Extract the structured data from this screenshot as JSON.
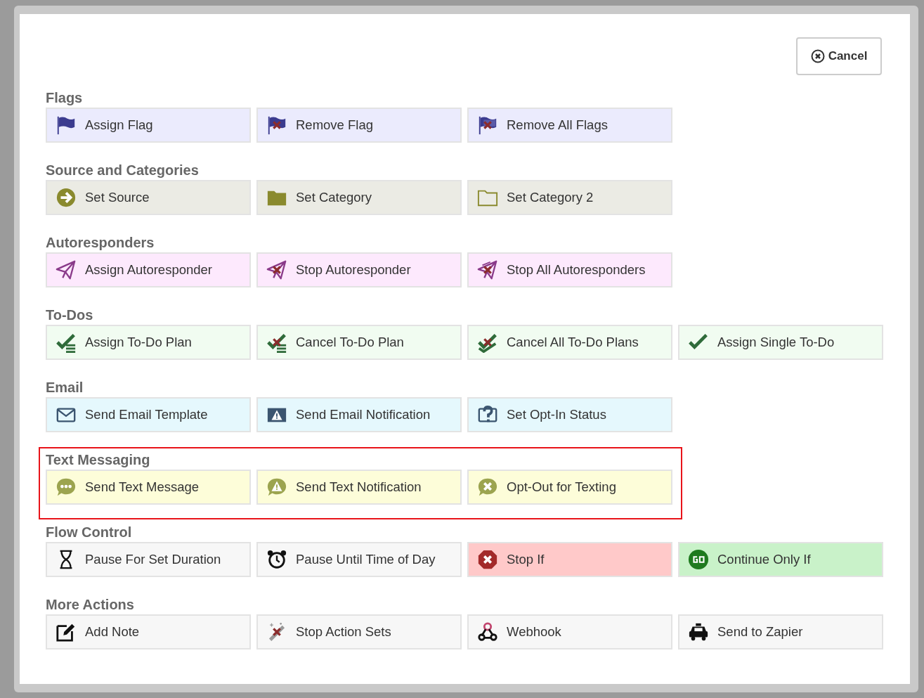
{
  "cancel_button": {
    "label": "Cancel"
  },
  "sections": [
    {
      "title": "Flags",
      "highlighted": false,
      "actions": [
        {
          "label": "Assign Flag",
          "color": "#ebebfd"
        },
        {
          "label": "Remove Flag",
          "color": "#ebebfd"
        },
        {
          "label": "Remove All Flags",
          "color": "#ebebfd"
        }
      ]
    },
    {
      "title": "Source and Categories",
      "highlighted": false,
      "actions": [
        {
          "label": "Set Source",
          "color": "#ebebe4"
        },
        {
          "label": "Set Category",
          "color": "#ebebe4"
        },
        {
          "label": "Set Category 2",
          "color": "#ebebe4"
        }
      ]
    },
    {
      "title": "Autoresponders",
      "highlighted": false,
      "actions": [
        {
          "label": "Assign Autoresponder",
          "color": "#fde9fd"
        },
        {
          "label": "Stop Autoresponder",
          "color": "#fde9fd"
        },
        {
          "label": "Stop All Autoresponders",
          "color": "#fde9fd"
        }
      ]
    },
    {
      "title": "To-Dos",
      "highlighted": false,
      "actions": [
        {
          "label": "Assign To-Do Plan",
          "color": "#f1fcf1"
        },
        {
          "label": "Cancel To-Do Plan",
          "color": "#f1fcf1"
        },
        {
          "label": "Cancel All To-Do Plans",
          "color": "#f1fcf1"
        },
        {
          "label": "Assign Single To-Do",
          "color": "#f1fcf1"
        }
      ]
    },
    {
      "title": "Email",
      "highlighted": false,
      "actions": [
        {
          "label": "Send Email Template",
          "color": "#e5f8fd"
        },
        {
          "label": "Send Email Notification",
          "color": "#e5f8fd"
        },
        {
          "label": "Set Opt-In Status",
          "color": "#e5f8fd"
        }
      ]
    },
    {
      "title": "Text Messaging",
      "highlighted": true,
      "actions": [
        {
          "label": "Send Text Message",
          "color": "#fdfdd9"
        },
        {
          "label": "Send Text Notification",
          "color": "#fdfdd9"
        },
        {
          "label": "Opt-Out for Texting",
          "color": "#fdfdd9"
        }
      ]
    },
    {
      "title": "Flow Control",
      "highlighted": false,
      "actions": [
        {
          "label": "Pause For Set Duration",
          "color": "#f7f7f7"
        },
        {
          "label": "Pause Until Time of Day",
          "color": "#f7f7f7"
        },
        {
          "label": "Stop If",
          "color": "#ffc9c9"
        },
        {
          "label": "Continue Only If",
          "color": "#c9f2c9"
        }
      ]
    },
    {
      "title": "More Actions",
      "highlighted": false,
      "actions": [
        {
          "label": "Add Note",
          "color": "#f7f7f7"
        },
        {
          "label": "Stop Action Sets",
          "color": "#f7f7f7"
        },
        {
          "label": "Webhook",
          "color": "#f7f7f7"
        },
        {
          "label": "Send to Zapier",
          "color": "#f7f7f7"
        }
      ]
    }
  ]
}
